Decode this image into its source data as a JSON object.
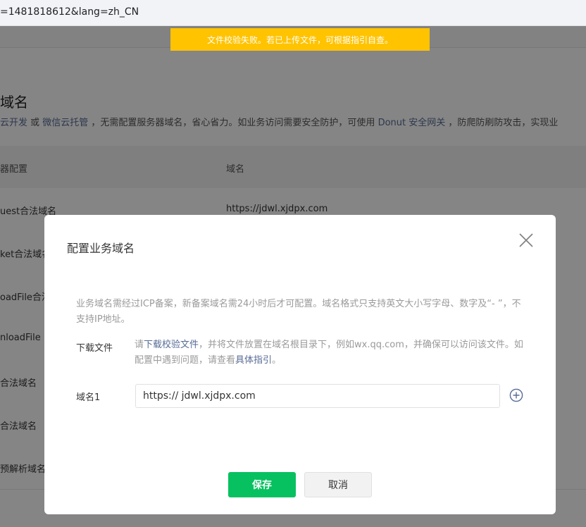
{
  "browser": {
    "address": "=1481818612&lang=zh_CN"
  },
  "toast": {
    "text": "文件校验失败。若已上传文件，可根据指引自查。"
  },
  "page": {
    "title": "域名",
    "desc_prefix": "云开发",
    "desc_or": " 或 ",
    "desc_link2": "微信云托管",
    "desc_mid": " ，无需配置服务器域名，省心省力。如业务访问需要安全防护，可使用 ",
    "desc_link3": "Donut 安全网关",
    "desc_suffix": " ，防爬防刷防攻击，实现业",
    "table": {
      "col1": "器配置",
      "col2": "域名",
      "rows": [
        {
          "name": "uest合法域名",
          "value": "https://jdwl.xjdpx.com"
        },
        {
          "name": "ket合法域名",
          "value": ""
        },
        {
          "name": "oadFile合法",
          "value": ""
        },
        {
          "name": "nloadFile",
          "value": ""
        },
        {
          "name": "合法域名",
          "value": ""
        },
        {
          "name": "合法域名",
          "value": ""
        },
        {
          "name": "预解析域名",
          "value": ""
        }
      ]
    }
  },
  "dialog": {
    "title": "配置业务域名",
    "tip": "业务域名需经过ICP备案，新备案域名需24小时后才可配置。域名格式只支持英文大小写字母、数字及“- ”，不支持IP地址。",
    "download_label": "下载文件",
    "download_text_1": "请",
    "download_link": "下载校验文件",
    "download_text_2": "，并将文件放置在域名根目录下，例如wx.qq.com，并确保可以访问该文件。如配置中遇到问题，请查看",
    "guide_link": "具体指引",
    "download_text_3": "。",
    "domain_label": "域名1",
    "domain_value": "https:// jdwl.xjdpx.com",
    "save_label": "保存",
    "cancel_label": "取消"
  }
}
